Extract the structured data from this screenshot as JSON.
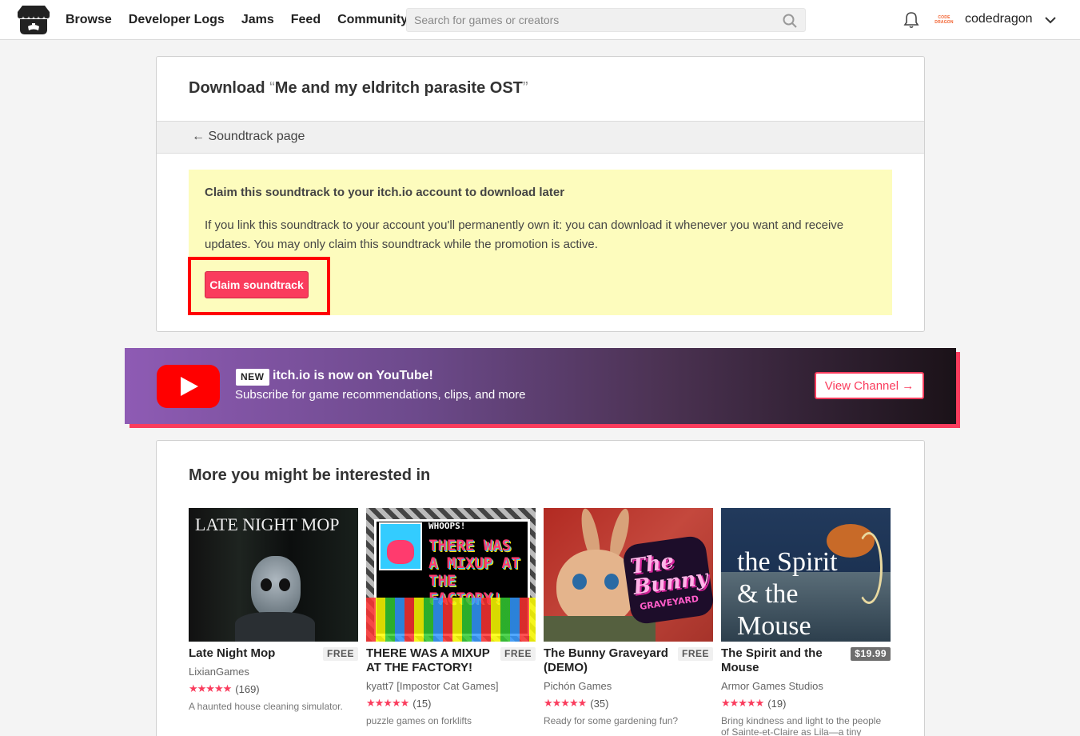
{
  "header": {
    "nav": [
      "Browse",
      "Developer Logs",
      "Jams",
      "Feed",
      "Community"
    ],
    "search_placeholder": "Search for games or creators",
    "avatar_text": [
      "CODE",
      "DRAGON"
    ],
    "username": "codedragon"
  },
  "download": {
    "title_prefix": "Download",
    "title_open_quote": "“",
    "title_name": "Me and my eldritch parasite OST",
    "title_close_quote": "”",
    "back_link": "← Soundtrack page",
    "claim_title": "Claim this soundtrack to your itch.io account to download later",
    "claim_text": "If you link this soundtrack to your account you'll permanently own it: you can download it whenever you want and receive updates. You may only claim this soundtrack while the promotion is active.",
    "claim_button": "Claim soundtrack"
  },
  "banner": {
    "badge": "NEW",
    "title": "itch.io is now on YouTube!",
    "subtitle": "Subscribe for game recommendations, clips, and more",
    "button": "View Channel →"
  },
  "more": {
    "title": "More you might be interested in",
    "games": [
      {
        "title": "Late Night Mop",
        "price": "FREE",
        "author": "LixianGames",
        "stars": "★★★★★",
        "count": "(169)",
        "desc": "A haunted house cleaning simulator.",
        "thumb_text": "LATE NIGHT MOP"
      },
      {
        "title": "THERE WAS A MIXUP AT THE FACTORY!",
        "price": "FREE",
        "author": "kyatt7 [Impostor Cat Games]",
        "stars": "★★★★★",
        "count": "(15)",
        "desc": "puzzle games on forklifts",
        "thumb_text": "THERE WAS A MIXUP AT THE FACTORY!",
        "thumb_sub": "WHOOPS!"
      },
      {
        "title": "The Bunny Graveyard (DEMO)",
        "price": "FREE",
        "author": "Pichón Games",
        "stars": "★★★★★",
        "count": "(35)",
        "desc": "Ready for some gardening fun?",
        "thumb_text": "The Bunny",
        "thumb_sub": "GRAVEYARD"
      },
      {
        "title": "The Spirit and the Mouse",
        "price": "$19.99",
        "author": "Armor Games Studios",
        "stars": "★★★★★",
        "count": "(19)",
        "desc": "Bring kindness and light to the people of Sainte-et-Claire as Lila—a tiny mouse",
        "thumb_text": "the Spirit & the Mouse"
      }
    ]
  },
  "colors": {
    "accent": "#fa3c5d",
    "highlight": "#ff0000",
    "claim_bg": "#fdfcbd"
  }
}
